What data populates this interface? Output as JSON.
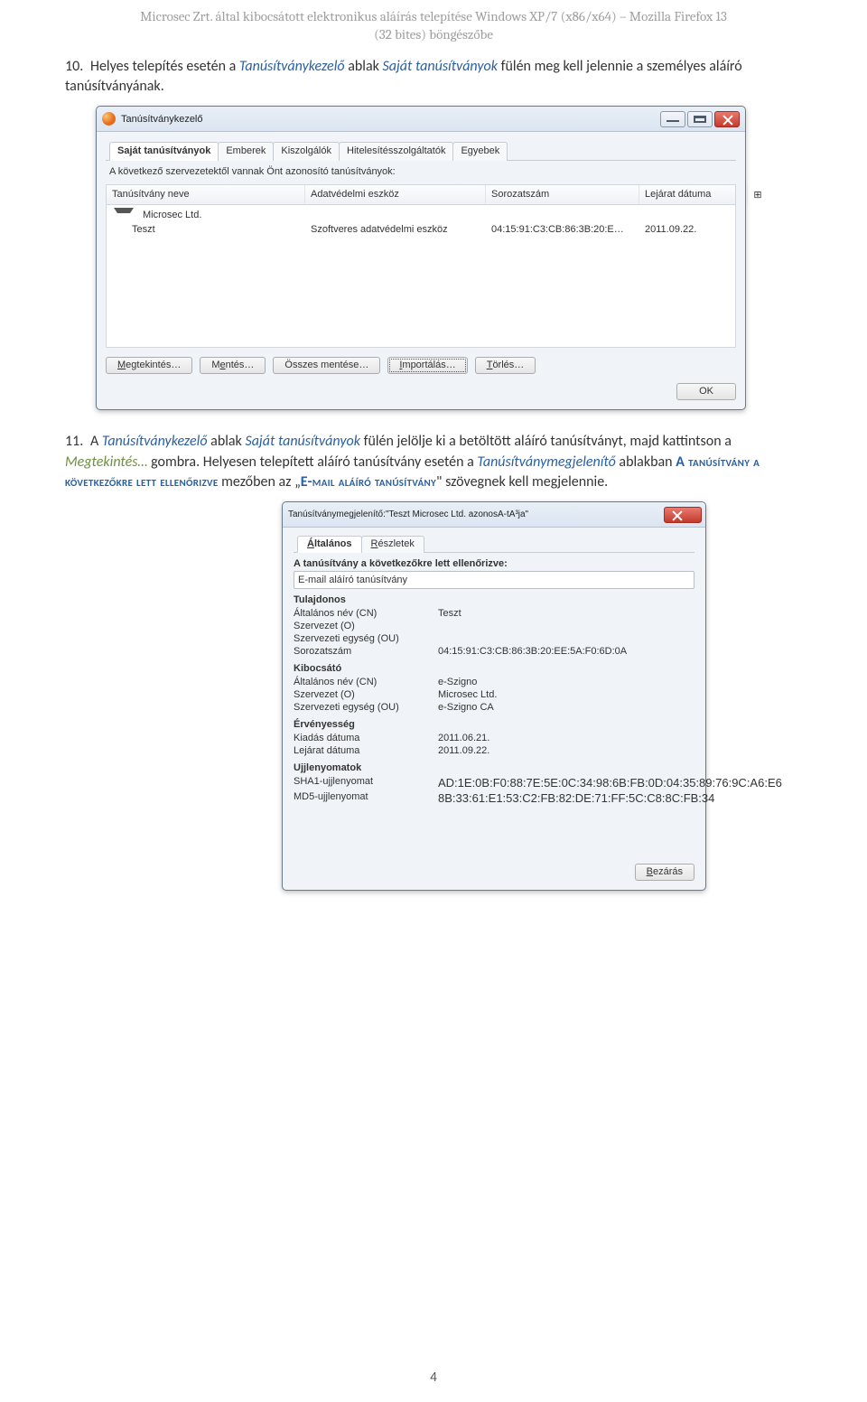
{
  "header": {
    "line1": "Microsec Zrt. által kibocsátott elektronikus aláírás telepítése Windows XP/7 (x86/x64) – Mozilla Firefox 13",
    "line2": "(32 bites) böngészőbe"
  },
  "para10": {
    "num": "10.",
    "t1": "Helyes telepítés esetén a ",
    "t2": "Tanúsítványkezelő",
    "t3": " ablak ",
    "t4": "Saját tanúsítványok",
    "t5": " fülén meg kell jelennie a személyes aláíró tanúsítványának."
  },
  "win1": {
    "title": "Tanúsítványkezelő",
    "tabs": [
      "Saját tanúsítványok",
      "Emberek",
      "Kiszolgálók",
      "Hitelesítésszolgáltatók",
      "Egyebek"
    ],
    "info": "A következő szervezetektől vannak Önt azonosító tanúsítványok:",
    "cols": [
      "Tanúsítvány neve",
      "Adatvédelmi eszköz",
      "Sorozatszám",
      "Lejárat dátuma",
      "⊞"
    ],
    "group": "Microsec Ltd.",
    "row": {
      "name": "Teszt",
      "tool": "Szoftveres adatvédelmi eszköz",
      "serial": "04:15:91:C3:CB:86:3B:20:E…",
      "expiry": "2011.09.22."
    },
    "btns": {
      "view": "Megtekintés…",
      "backup": "Mentés…",
      "backupall": "Összes mentése…",
      "import": "Importálás…",
      "delete": "Törlés…"
    },
    "ok": "OK"
  },
  "para11": {
    "num": "11.",
    "t1": "A ",
    "t2": "Tanúsítványkezelő",
    "t3": " ablak ",
    "t4": "Saját tanúsítványok",
    "t5": " fülén jelölje ki a betöltött aláíró tanúsítványt, majd kattintson a ",
    "t6": "Megtekintés…",
    "t7": " gombra. Helyesen telepített aláíró tanúsítvány esetén a ",
    "t8": "Tanúsítványmegjelenítő",
    "t9": " ablakban ",
    "t10": "A tanúsítvány a következőkre lett ellenőrizve",
    "t11": " mezőben az „",
    "t12": "E-mail aláíró tanúsítvány",
    "t13": "\" szövegnek kell megjelennie."
  },
  "win2": {
    "title": "Tanúsítványmegjelenítő:\"Teszt Microsec Ltd. azonosA-tA³ja\"",
    "tabs": [
      "Általános",
      "Részletek"
    ],
    "verified_label": "A tanúsítvány a következőkre lett ellenőrizve:",
    "verified_value": "E-mail aláíró tanúsítvány",
    "subject_label": "Tulajdonos",
    "subject": {
      "cn_label": "Általános név (CN)",
      "cn": "Teszt",
      "o_label": "Szervezet (O)",
      "o": "",
      "ou_label": "Szervezeti egység (OU)",
      "ou": "",
      "serial_label": "Sorozatszám",
      "serial": "04:15:91:C3:CB:86:3B:20:EE:5A:F0:6D:0A"
    },
    "issuer_label": "Kibocsátó",
    "issuer": {
      "cn_label": "Általános név (CN)",
      "cn": "e-Szigno",
      "o_label": "Szervezet (O)",
      "o": "Microsec Ltd.",
      "ou_label": "Szervezeti egység (OU)",
      "ou": "e-Szigno CA"
    },
    "validity_label": "Érvényesség",
    "validity": {
      "from_label": "Kiadás dátuma",
      "from": "2011.06.21.",
      "to_label": "Lejárat dátuma",
      "to": "2011.09.22."
    },
    "fp_label": "Ujjlenyomatok",
    "fp": {
      "sha1_label": "SHA1-ujjlenyomat",
      "sha1": "AD:1E:0B:F0:88:7E:5E:0C:34:98:6B:FB:0D:04:35:89:76:9C:A6:E6",
      "md5_label": "MD5-ujjlenyomat",
      "md5": "8B:33:61:E1:53:C2:FB:82:DE:71:FF:5C:C8:8C:FB:34"
    },
    "close": "Bezárás"
  },
  "pagenum": "4"
}
